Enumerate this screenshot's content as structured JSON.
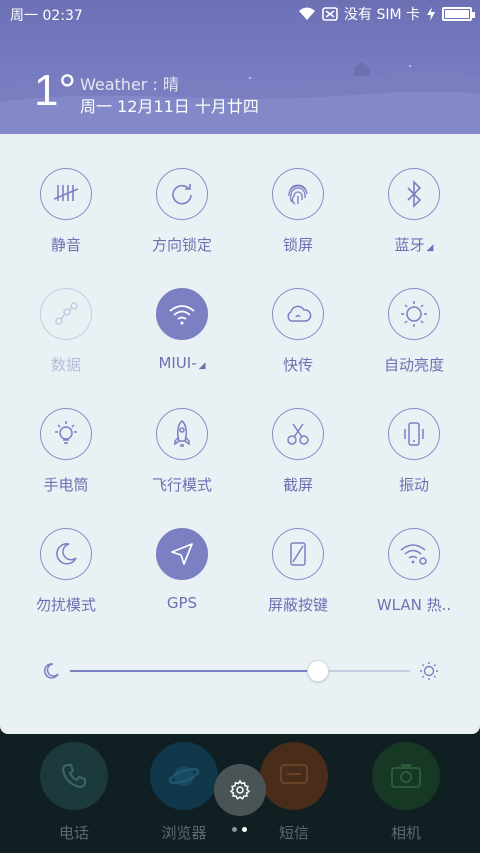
{
  "status_bar": {
    "time": "周一 02:37",
    "carrier": "没有 SIM 卡"
  },
  "weather": {
    "temperature": "1°",
    "description": "Weather : 晴",
    "date": "周一 12月11日 十月廿四"
  },
  "toggles": [
    {
      "label": "静音",
      "icon": "mute-icon",
      "state": "off"
    },
    {
      "label": "方向锁定",
      "icon": "rotation-lock-icon",
      "state": "off"
    },
    {
      "label": "锁屏",
      "icon": "fingerprint-icon",
      "state": "off"
    },
    {
      "label": "蓝牙",
      "icon": "bluetooth-icon",
      "state": "off",
      "expand": true
    },
    {
      "label": "数据",
      "icon": "data-icon",
      "state": "disabled"
    },
    {
      "label": "MIUI-",
      "icon": "wifi-icon",
      "state": "on",
      "expand": true
    },
    {
      "label": "快传",
      "icon": "cloud-icon",
      "state": "off"
    },
    {
      "label": "自动亮度",
      "icon": "auto-brightness-icon",
      "state": "off"
    },
    {
      "label": "手电筒",
      "icon": "flashlight-icon",
      "state": "off"
    },
    {
      "label": "飞行模式",
      "icon": "airplane-icon",
      "state": "off"
    },
    {
      "label": "截屏",
      "icon": "scissors-icon",
      "state": "off"
    },
    {
      "label": "振动",
      "icon": "vibrate-icon",
      "state": "off"
    },
    {
      "label": "勿扰模式",
      "icon": "moon-icon",
      "state": "off"
    },
    {
      "label": "GPS",
      "icon": "location-arrow-icon",
      "state": "on"
    },
    {
      "label": "屏蔽按键",
      "icon": "block-keys-icon",
      "state": "off"
    },
    {
      "label": "WLAN 热..",
      "icon": "hotspot-icon",
      "state": "off"
    }
  ],
  "brightness": {
    "level": 0.73
  },
  "dock": [
    {
      "label": "电话",
      "icon": "phone-icon"
    },
    {
      "label": "浏览器",
      "icon": "browser-icon"
    },
    {
      "label": "短信",
      "icon": "message-icon"
    },
    {
      "label": "相机",
      "icon": "camera-icon"
    }
  ],
  "colors": {
    "accent": "#7b80c2",
    "panel": "#eaf1f4",
    "header": "#787cc0"
  }
}
